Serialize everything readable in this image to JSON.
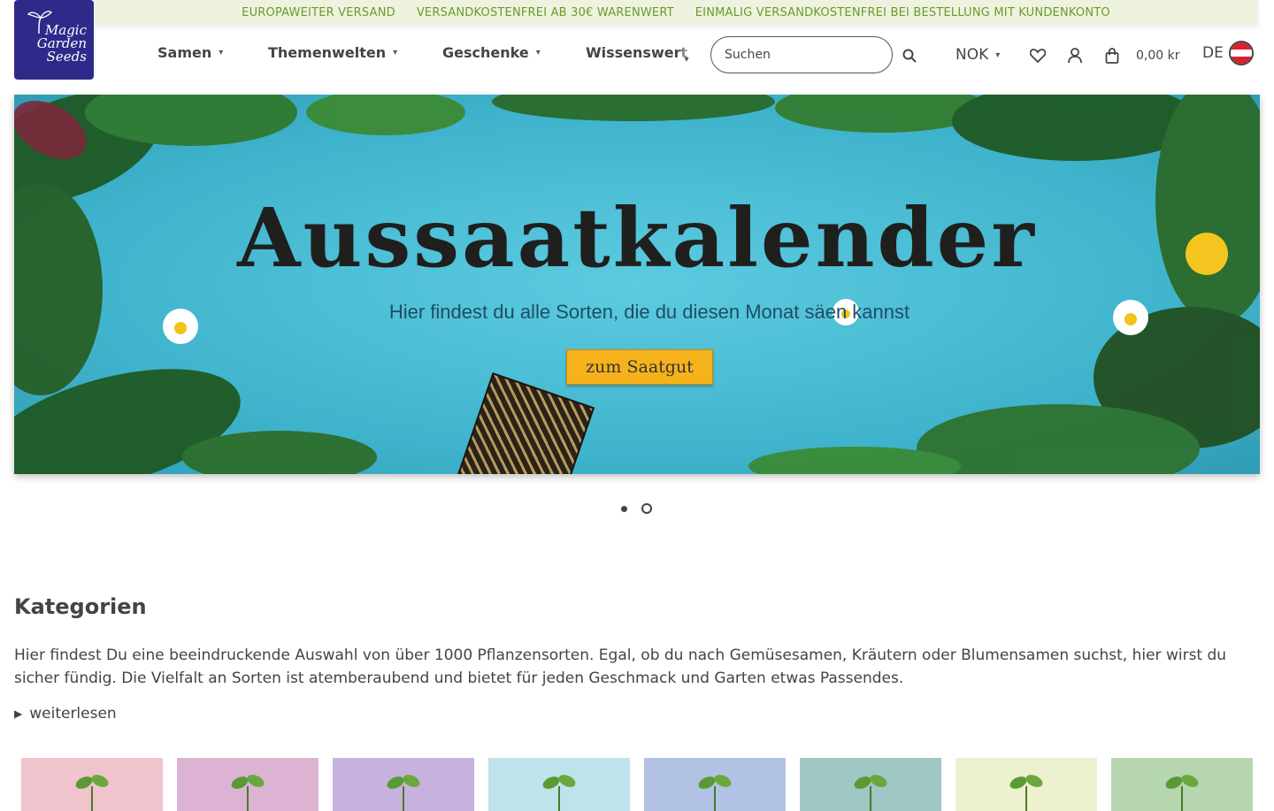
{
  "announcement": {
    "items": [
      "EUROPAWEITER VERSAND",
      "VERSANDKOSTENFREI AB 30€ WARENWERT",
      "EINMALIG VERSANDKOSTENFREI BEI BESTELLUNG MIT KUNDENKONTO"
    ]
  },
  "logo": {
    "line1": "Magic",
    "line2": "Garden",
    "line3": "Seeds"
  },
  "nav": {
    "items": [
      {
        "label": "Samen"
      },
      {
        "label": "Themenwelten"
      },
      {
        "label": "Geschenke"
      },
      {
        "label": "Wissenswert"
      }
    ]
  },
  "header": {
    "search_placeholder": "Suchen",
    "currency": "NOK",
    "cart_total": "0,00 kr",
    "language": "DE"
  },
  "hero": {
    "title": "Aussaatkalender",
    "subtitle": "Hier findest du alle Sorten, die du diesen Monat säen kannst",
    "button": "zum Saatgut",
    "slide_count": 2,
    "active_slide": 1
  },
  "categories": {
    "title": "Kategorien",
    "description": "Hier findest Du eine beeindruckende Auswahl von über 1000 Pflanzensorten. Egal, ob du nach Gemüsesamen, Kräutern oder Blumensamen suchst, hier wirst du sicher fündig. Die Vielfalt an Sorten ist atemberaubend und bietet für jeden Geschmack und Garten etwas Passendes.",
    "read_more": "weiterlesen",
    "tile_colors": [
      "#f0c4cc",
      "#dcb3d2",
      "#c6b2dd",
      "#bfe3ea",
      "#b2c2e4",
      "#9fc7c3",
      "#eef1cf",
      "#b6d6b0"
    ]
  },
  "colors": {
    "announcement_bg": "#eef3df",
    "announcement_text": "#6b9a2a",
    "logo_bg": "#2f2a8a",
    "hero_bg": "#44b8cf",
    "hero_button": "#f6b21a"
  },
  "icons": {
    "search": "search-icon",
    "wishlist": "heart-icon",
    "account": "user-icon",
    "cart": "cart-icon",
    "language_flag": "austria-flag-icon"
  }
}
